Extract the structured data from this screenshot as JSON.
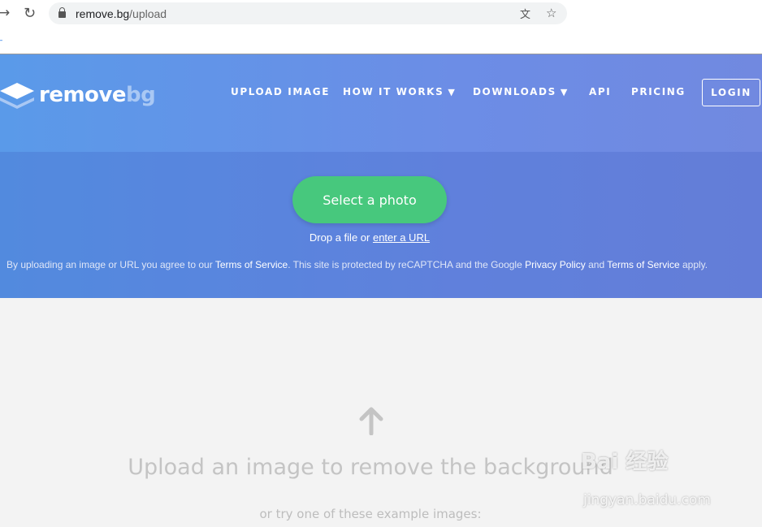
{
  "browser": {
    "url_host": "remove.bg",
    "url_path": "/upload",
    "bookmark_text": "_",
    "icons": [
      "forward-icon",
      "reload-icon",
      "lock-icon",
      "translate-icon",
      "star-icon"
    ]
  },
  "header": {
    "logo_main": "remove",
    "logo_accent": "bg",
    "nav": [
      {
        "label": "UPLOAD IMAGE"
      },
      {
        "label": "HOW IT WORKS",
        "dropdown": true
      },
      {
        "label": "DOWNLOADS",
        "dropdown": true
      },
      {
        "label": "API"
      },
      {
        "label": "PRICING"
      }
    ],
    "login": "LOGIN"
  },
  "hero": {
    "select_button": "Select a photo",
    "drop_text": "Drop a file or ",
    "url_link": "enter a URL",
    "terms": {
      "t1": "By uploading an image or URL you agree to our ",
      "l1": "Terms of Service",
      "t2": ". This site is protected by reCAPTCHA and the Google ",
      "l2": "Privacy Policy",
      "t3": " and ",
      "l3": "Terms of Service",
      "t4": " apply."
    }
  },
  "main": {
    "heading": "Upload an image to remove the background",
    "subheading": "or try one of these example images:"
  },
  "watermark": {
    "brand": "Bai 经验",
    "site": "jingyan.baidu.com"
  },
  "colors": {
    "accent_green": "#47c87d",
    "hero_blue": "#5a9ae9"
  }
}
